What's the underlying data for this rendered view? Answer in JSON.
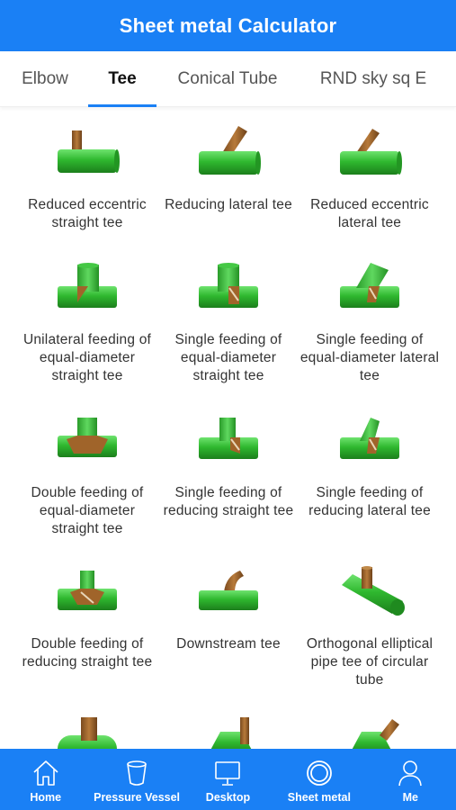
{
  "header": {
    "title": "Sheet metal Calculator"
  },
  "tabs": [
    {
      "label": "Elbow",
      "active": false
    },
    {
      "label": "Tee",
      "active": true
    },
    {
      "label": "Conical Tube",
      "active": false
    },
    {
      "label": "RND sky sq E",
      "active": false
    }
  ],
  "items": [
    {
      "label": "Reduced eccentric straight tee",
      "icon": "reduced-eccentric-straight-tee-icon"
    },
    {
      "label": "Reducing lateral tee",
      "icon": "reducing-lateral-tee-icon"
    },
    {
      "label": "Reduced eccentric lateral tee",
      "icon": "reduced-eccentric-lateral-tee-icon"
    },
    {
      "label": "Unilateral feeding of equal-diameter straight tee",
      "icon": "unilateral-feeding-tee-icon"
    },
    {
      "label": "Single feeding of equal-diameter straight tee",
      "icon": "single-feeding-straight-tee-icon"
    },
    {
      "label": "Single feeding of equal-diameter lateral tee",
      "icon": "single-feeding-lateral-tee-icon"
    },
    {
      "label": "Double feeding of equal-diameter straight tee",
      "icon": "double-feeding-straight-tee-icon"
    },
    {
      "label": "Single feeding of reducing straight tee",
      "icon": "single-feeding-reducing-straight-tee-icon"
    },
    {
      "label": "Single feeding of reducing lateral tee",
      "icon": "single-feeding-reducing-lateral-tee-icon"
    },
    {
      "label": "Double feeding of reducing straight tee",
      "icon": "double-feeding-reducing-straight-tee-icon"
    },
    {
      "label": "Downstream tee",
      "icon": "downstream-tee-icon"
    },
    {
      "label": "Orthogonal elliptical pipe tee of circular tube",
      "icon": "orthogonal-elliptical-pipe-tee-icon"
    },
    {
      "label": "",
      "icon": "pipe-tee-partial-icon"
    },
    {
      "label": "",
      "icon": "cone-tee-partial-icon"
    },
    {
      "label": "",
      "icon": "cone-lateral-tee-partial-icon"
    }
  ],
  "bottom_nav": [
    {
      "label": "Home",
      "icon": "home-icon"
    },
    {
      "label": "Pressure Vessel",
      "icon": "pressure-vessel-icon"
    },
    {
      "label": "Desktop",
      "icon": "desktop-icon"
    },
    {
      "label": "Sheet metal",
      "icon": "sheet-metal-icon"
    },
    {
      "label": "Me",
      "icon": "person-icon"
    }
  ],
  "colors": {
    "primary": "#1a80f5",
    "pipe_green": "#2fb82f",
    "pipe_brown": "#a0642a"
  }
}
